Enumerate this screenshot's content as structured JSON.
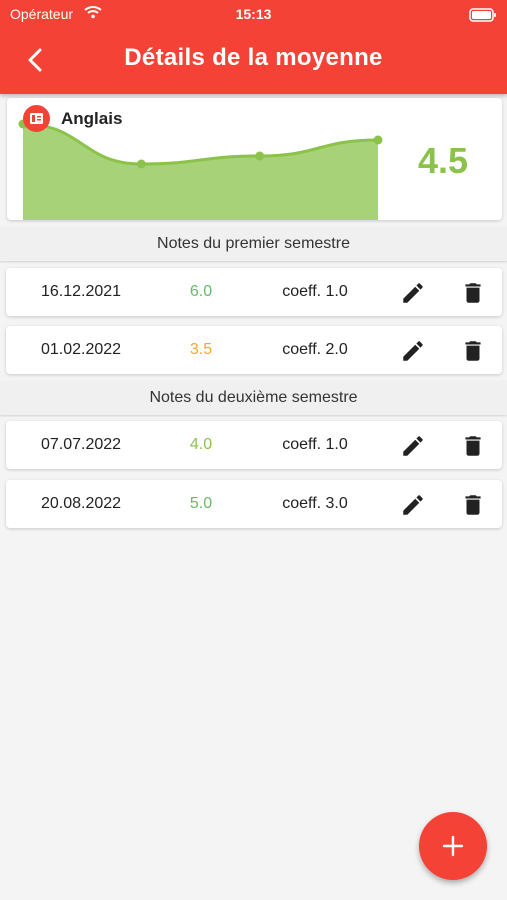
{
  "status_bar": {
    "carrier": "Opérateur",
    "time": "15:13"
  },
  "header": {
    "title": "Détails de la moyenne",
    "back_icon": "chevron-left-icon"
  },
  "subject": {
    "name": "Anglais",
    "average": "4.5",
    "badge_icon": "book-icon",
    "badge_color": "#f44336",
    "average_color": "#8bc34a"
  },
  "chart_data": {
    "type": "area",
    "title": "",
    "series": [
      {
        "values": [
          6.0,
          3.5,
          4.0,
          5.0
        ]
      }
    ],
    "ylim": [
      0,
      6
    ],
    "color": "#8bc34a",
    "grid": false
  },
  "sections": [
    {
      "title": "Notes du premier semestre",
      "grades": [
        {
          "date": "16.12.2021",
          "value": "6.0",
          "coeff": "coeff. 1.0",
          "color": "#66bb6a"
        },
        {
          "date": "01.02.2022",
          "value": "3.5",
          "coeff": "coeff. 2.0",
          "color": "#ffa726"
        }
      ]
    },
    {
      "title": "Notes du deuxième semestre",
      "grades": [
        {
          "date": "07.07.2022",
          "value": "4.0",
          "coeff": "coeff. 1.0",
          "color": "#8bc34a"
        },
        {
          "date": "20.08.2022",
          "value": "5.0",
          "coeff": "coeff. 3.0",
          "color": "#66bb6a"
        }
      ]
    }
  ],
  "actions": {
    "edit_icon": "pencil-icon",
    "delete_icon": "trash-icon",
    "fab_icon": "plus-icon"
  },
  "colors": {
    "accent": "#f44336",
    "background": "#f4f4f4"
  }
}
